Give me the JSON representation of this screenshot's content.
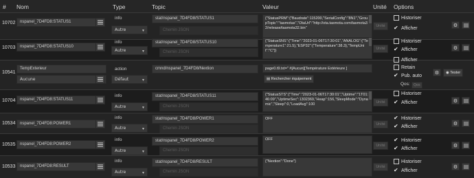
{
  "columns": {
    "hash": "#",
    "name": "Nom",
    "type": "Type",
    "topic": "Topic",
    "value": "Valeur",
    "unit": "Unité",
    "options": "Options"
  },
  "placeholders": {
    "json_path": "Chemin JSON",
    "unit": "Unité",
    "qos": "Qos"
  },
  "labels": {
    "historiser": "Historiser",
    "afficher": "Afficher",
    "retain": "Retain",
    "pub_auto": "Pub. auto",
    "qos": "Qos:",
    "tester": "Tester",
    "search_equipment": "Rechercher équipement"
  },
  "rows": [
    {
      "id": "10702",
      "name": "nspanel_7D4FD8:STATUS1",
      "type": "info",
      "subtype": "Autre",
      "topic": "stat/nspanel_7D4FD8/STATUS1",
      "value": "{\"StatusPRM\":{\"Baudrate\":115200,\"SerialConfig\":\"8N1\",\"GroupTopic\":\"tasmotas\",\"OtaUrl\":\"http://ota.tasmota.com/tasmota32/release/tasmota32.bin\""
    },
    {
      "id": "10703",
      "name": "nspanel_7D4FD8:STATUS10",
      "type": "info",
      "subtype": "Autre",
      "topic": "stat/nspanel_7D4FD8/STATUS10",
      "value": "{\"StatusSNS\":{\"Time\":\"2023-01-06T17:30:01\",\"ANALOG\":{\"Temperature1\":21.5},\"ESP32\":{\"Temperature\":38.3},\"TempUnit\":\"C\"}}"
    },
    {
      "id": "10541",
      "name": "TempExterieur",
      "subtype": "Aucune",
      "type": "action",
      "subtype2": "Défaut",
      "topic": "cmnd/nspanel_7D4FD8/Nextion",
      "value": "page0.t9.txt=\" #[Aucun][Température Extérieure ]"
    },
    {
      "id": "10704",
      "name": "nspanel_7D4FD8:STATUS11",
      "type": "info",
      "subtype": "Autre",
      "topic": "stat/nspanel_7D4FD8/STATUS11",
      "value": "{\"StatusSTS\":{\"Time\":\"2023-01-06T17:30:01\",\"Uptime\":\"1T01:46:09\",\"UptimeSec\":1302369,\"Heap\":156,\"SleepMode\":\"Dynamic\",\"Sleep\":0,\"LoadAvg\":100"
    },
    {
      "id": "10534",
      "name": "nspanel_7D4FD8:POWER1",
      "type": "info",
      "subtype": "Autre",
      "topic": "stat/nspanel_7D4FD8/POWER1",
      "value": "OFF"
    },
    {
      "id": "10535",
      "name": "nspanel_7D4FD8:POWER2",
      "type": "info",
      "subtype": "Autre",
      "topic": "stat/nspanel_7D4FD8/POWER2",
      "value": "OFF"
    },
    {
      "id": "10533",
      "name": "nspanel_7D4FD8:RESULT",
      "type": "info",
      "subtype": "Autre",
      "topic": "stat/nspanel_7D4FD8/RESULT",
      "value": "{\"Nextion\":\"Done\"}"
    }
  ]
}
